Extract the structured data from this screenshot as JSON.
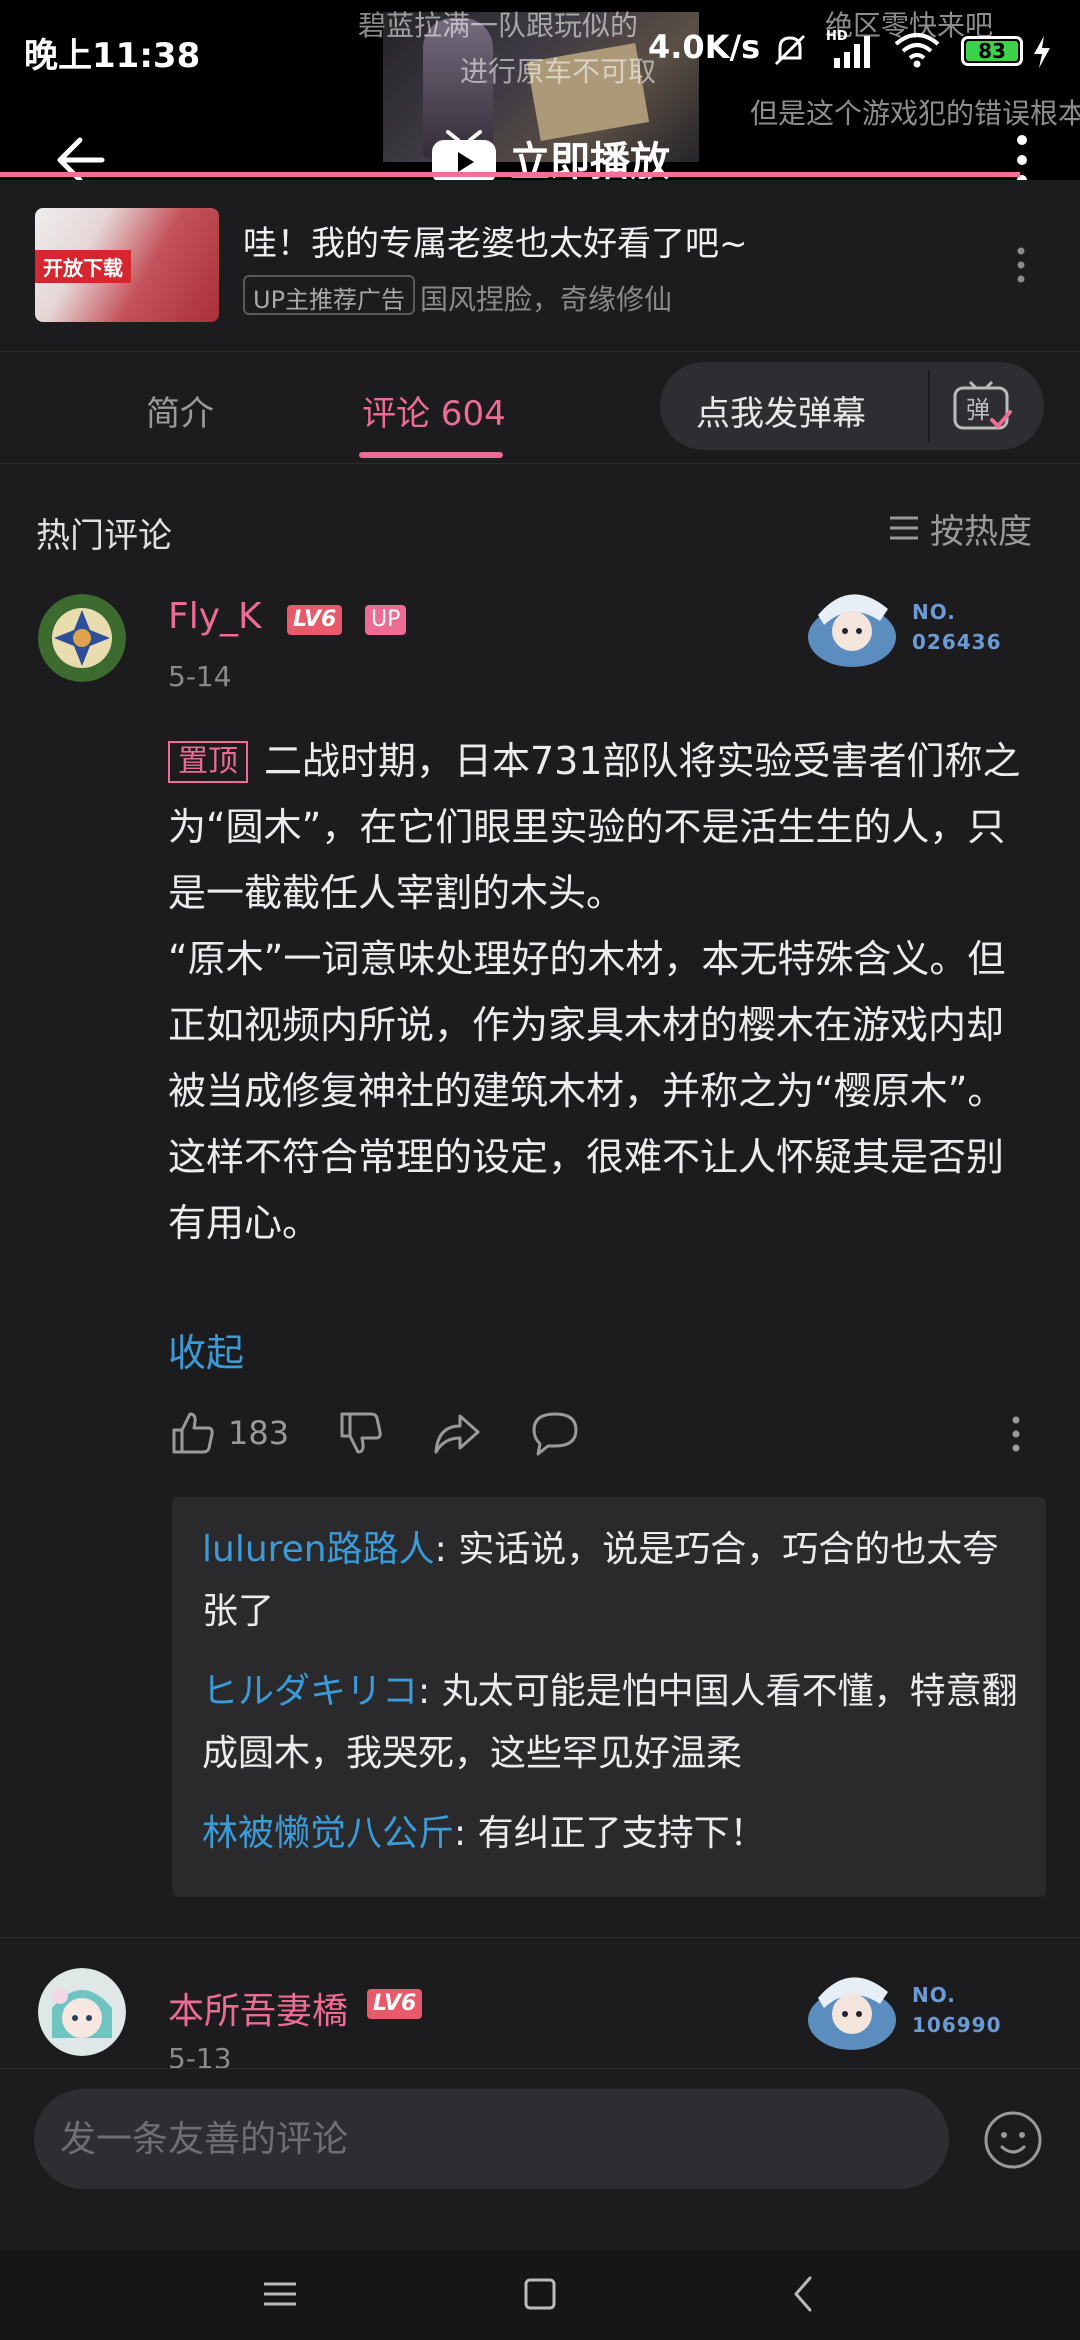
{
  "status_bar": {
    "time": "晚上11:38",
    "network_speed": "4.0K/s",
    "battery": "83"
  },
  "video": {
    "danmaku": [
      "碧蓝拉满一队跟玩似的",
      "绝区零快来吧",
      "但是这个游戏犯的错误根本",
      "进行原车不可取"
    ],
    "play_now_label": "立即播放"
  },
  "ad": {
    "image_tag": "开放下载",
    "title": "哇！我的专属老婆也太好看了吧~",
    "badge": "UP主推荐广告",
    "subtitle": "国风捏脸，奇缘修仙"
  },
  "tabs": {
    "intro": "简介",
    "comments": "评论 604",
    "danmaku_button": "点我发弹幕",
    "danmaku_icon_char": "弹"
  },
  "comments_header": {
    "title": "热门评论",
    "sort_label": "按热度"
  },
  "pinned_comment": {
    "username": "Fly_K",
    "level": "LV6",
    "up_tag": "UP",
    "date": "5-14",
    "fan_no_label": "NO.",
    "fan_no": "026436",
    "pin_tag": "置顶",
    "paragraph_1": "二战时期，日本731部队将实验受害者们称之为“圆木”，在它们眼里实验的不是活生生的人，只是一截截任人宰割的木头。",
    "paragraph_2": "“原木”一词意味处理好的木材，本无特殊含义。但正如视频内所说，作为家具木材的樱木在游戏内却被当成修复神社的建筑木材，并称之为“樱原木”。",
    "paragraph_3": "这样不符合常理的设定，很难不让人怀疑其是否别有用心。",
    "collapse_label": "收起",
    "like_count": "183"
  },
  "replies": [
    {
      "user": "luluren路路人",
      "text": ": 实话说，说是巧合，巧合的也太夸张了"
    },
    {
      "user": "ヒルダキリコ",
      "text": ": 丸太可能是怕中国人看不懂，特意翻成圆木，我哭死，这些罕见好温柔"
    },
    {
      "user": "林被懒觉八公斤",
      "text": ": 有纠正了支持下！"
    }
  ],
  "second_comment": {
    "username": "本所吾妻橋",
    "level": "LV6",
    "date": "5-13",
    "fan_no_label": "NO.",
    "fan_no": "106990"
  },
  "input": {
    "placeholder": "发一条友善的评论"
  },
  "colors": {
    "accent_pink": "#ec6c94",
    "link_blue": "#3a9bd8",
    "background": "#1c1c1e"
  }
}
